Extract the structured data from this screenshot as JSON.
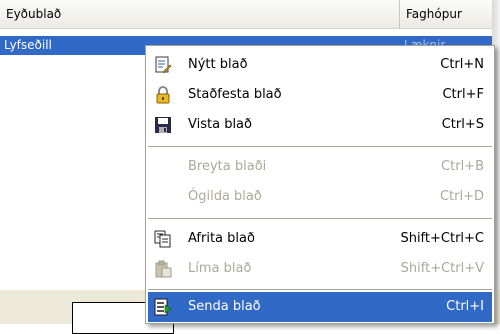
{
  "listview": {
    "columns": [
      "Eyðublað",
      "Faghópur"
    ],
    "rows": [
      {
        "col1": "Lyfseðill",
        "col2": "Læknir"
      }
    ]
  },
  "context_menu": {
    "items": [
      {
        "label": "Nýtt blað",
        "shortcut": "Ctrl+N",
        "icon": "new-sheet-icon",
        "enabled": true
      },
      {
        "label": "Staðfesta blað",
        "shortcut": "Ctrl+F",
        "icon": "lock-icon",
        "enabled": true
      },
      {
        "label": "Vista blað",
        "shortcut": "Ctrl+S",
        "icon": "floppy-disk-icon",
        "enabled": true
      },
      {
        "label": "Breyta blaði",
        "shortcut": "Ctrl+B",
        "icon": "",
        "enabled": false
      },
      {
        "label": "Ógilda blað",
        "shortcut": "Ctrl+D",
        "icon": "",
        "enabled": false
      },
      {
        "label": "Afrita blað",
        "shortcut": "Shift+Ctrl+C",
        "icon": "copy-icon",
        "enabled": true
      },
      {
        "label": "Líma blað",
        "shortcut": "Shift+Ctrl+V",
        "icon": "paste-icon",
        "enabled": false
      },
      {
        "label": "Senda blað",
        "shortcut": "Ctrl+I",
        "icon": "send-icon",
        "enabled": true,
        "highlighted": true
      }
    ]
  },
  "colors": {
    "selection": "#3169c6",
    "disabled_text": "#aca899",
    "header_bg": "#ebeae4"
  }
}
